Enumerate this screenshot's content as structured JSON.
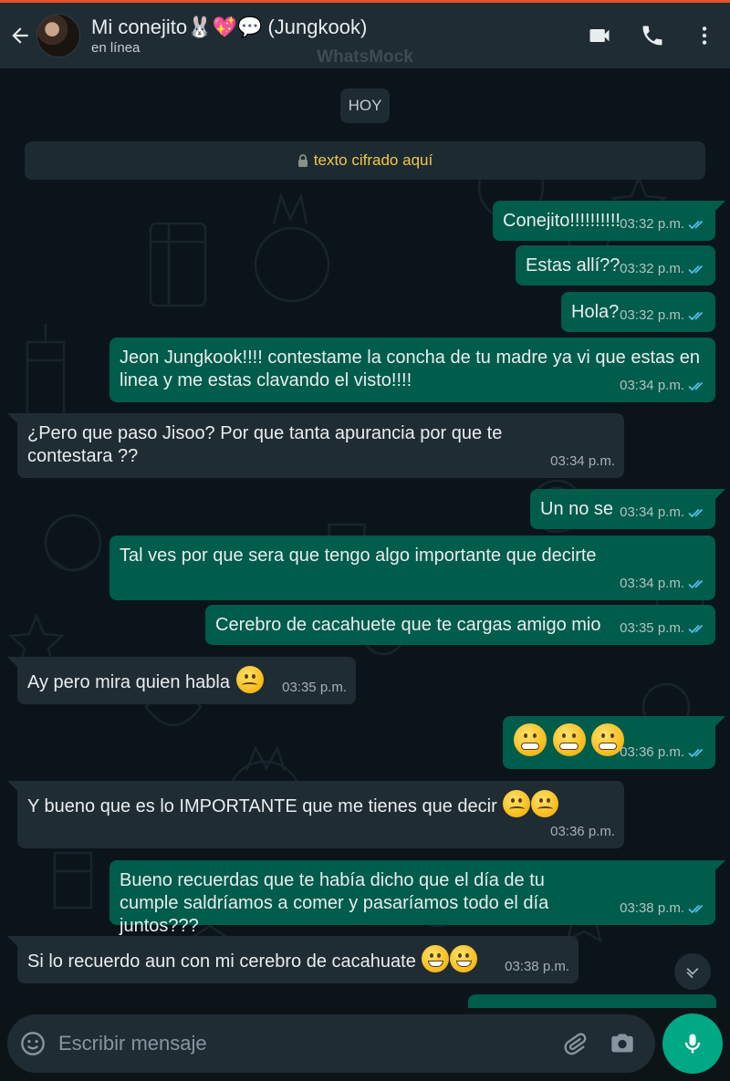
{
  "header": {
    "title": "Mi conejito🐰💖💬 (Jungkook)",
    "status": "en línea",
    "watermark": "WhatsMock"
  },
  "chat": {
    "date_label": "HOY",
    "encryption_notice": "texto cifrado aquí"
  },
  "messages": [
    {
      "dir": "out",
      "text": "Conejito!!!!!!!!!!",
      "time": "03:32 p.m."
    },
    {
      "dir": "out",
      "text": "Estas allí??",
      "time": "03:32 p.m."
    },
    {
      "dir": "out",
      "text": "Hola?",
      "time": "03:32 p.m."
    },
    {
      "dir": "out",
      "text": "Jeon Jungkook!!!! contestame la concha de tu madre ya vi que estas en linea y me estas clavando el visto!!!!",
      "time": "03:34 p.m."
    },
    {
      "dir": "in",
      "text": "¿Pero que paso Jisoo? Por que tanta apurancia por que te contestara ??",
      "time": "03:34 p.m."
    },
    {
      "dir": "out",
      "text": "Un no se",
      "time": "03:34 p.m."
    },
    {
      "dir": "out",
      "text": "Tal ves por que sera que tengo algo importante que decirte",
      "time": "03:34 p.m."
    },
    {
      "dir": "out",
      "text": "Cerebro de cacahuete que te cargas amigo mio",
      "time": "03:35 p.m."
    },
    {
      "dir": "in",
      "text": "Ay pero mira quien habla",
      "time": "03:35 p.m.",
      "emoji": [
        "persevering-face"
      ]
    },
    {
      "dir": "out",
      "text": "",
      "time": "03:36 p.m.",
      "emoji": [
        "grimacing-face",
        "grimacing-face",
        "grimacing-face"
      ]
    },
    {
      "dir": "in",
      "text": "Y bueno que es lo IMPORTANTE que me tienes que decir",
      "time": "03:36 p.m.",
      "emoji": [
        "thinking-face",
        "thinking-face"
      ]
    },
    {
      "dir": "out",
      "text": "Bueno recuerdas que te había dicho que el día de tu cumple saldríamos a comer  y pasaríamos todo el día juntos???",
      "time": "03:38 p.m."
    },
    {
      "dir": "in",
      "text": "Si lo recuerdo aun con mi cerebro de cacahuate",
      "time": "03:38 p.m.",
      "emoji": [
        "beaming-face",
        "grinning-sweat-face"
      ]
    }
  ],
  "composer": {
    "placeholder": "Escribir mensaje"
  },
  "colors": {
    "header_bg": "#1f2c34",
    "chat_bg": "#0b141a",
    "outgoing_bubble": "#005c4b",
    "incoming_bubble": "#202c33",
    "read_ticks": "#53bdeb",
    "encryption_text": "#f1c84b",
    "accent": "#00a884"
  },
  "icons": [
    "back-arrow-icon",
    "video-call-icon",
    "phone-icon",
    "more-options-icon",
    "lock-icon",
    "double-check-icon",
    "chevron-down-icon",
    "emoji-icon",
    "attach-icon",
    "camera-icon",
    "mic-icon"
  ]
}
